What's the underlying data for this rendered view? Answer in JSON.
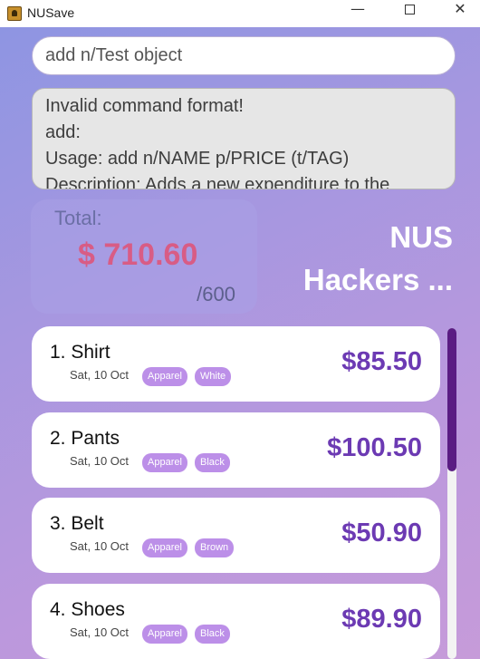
{
  "window": {
    "title": "NUSave",
    "minimize": "—",
    "close": "✕"
  },
  "command": {
    "value": "add n/Test object"
  },
  "result": {
    "lines": [
      "Invalid command format!",
      "add:",
      "Usage: add n/NAME p/PRICE (t/TAG)",
      "Description: Adds a new expenditure to the"
    ]
  },
  "total": {
    "label": "Total:",
    "amount": "$ 710.60",
    "budget": "/600"
  },
  "group": {
    "name_line1": "NUS",
    "name_line2": "Hackers ..."
  },
  "expenditures": [
    {
      "index_name": "1. Shirt",
      "date": "Sat, 10 Oct",
      "tags": [
        "Apparel",
        "White"
      ],
      "price": "$85.50"
    },
    {
      "index_name": "2. Pants",
      "date": "Sat, 10 Oct",
      "tags": [
        "Apparel",
        "Black"
      ],
      "price": "$100.50"
    },
    {
      "index_name": "3. Belt",
      "date": "Sat, 10 Oct",
      "tags": [
        "Apparel",
        "Brown"
      ],
      "price": "$50.90"
    },
    {
      "index_name": "4. Shoes",
      "date": "Sat, 10 Oct",
      "tags": [
        "Apparel",
        "Black"
      ],
      "price": "$89.90"
    }
  ],
  "scrollbar": {
    "position": 0.0
  },
  "colors": {
    "accent_price": "#6c3ab3",
    "total_amount": "#d85c85",
    "tag": "#bc8fe8",
    "scroll_thumb": "#5a1c83"
  }
}
